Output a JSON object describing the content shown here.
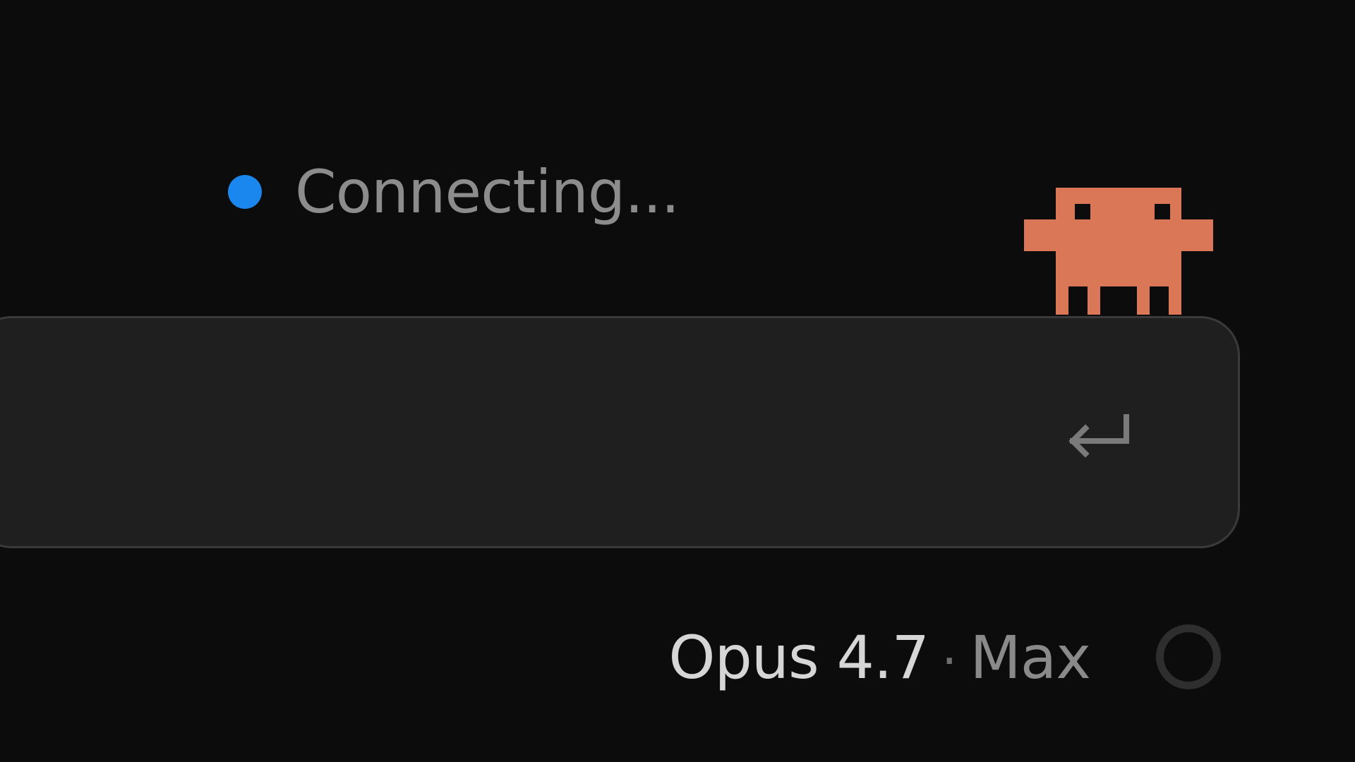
{
  "status": {
    "text": "Connecting...",
    "dot_color": "#1a87ee"
  },
  "mascot": {
    "icon": "pixel-creature-icon",
    "color": "#d97757"
  },
  "prompt": {
    "value": "",
    "placeholder": "",
    "submit_icon": "enter-return-icon"
  },
  "model": {
    "name": "Opus 4.7",
    "separator": "·",
    "tier": "Max"
  },
  "context_ring": {
    "icon": "context-usage-ring-icon"
  },
  "colors": {
    "background": "#0c0c0c",
    "input_background": "#1f1f1f",
    "input_border": "#3a3a3a",
    "muted_text": "#8c8c8c",
    "primary_text": "#d6d6d6"
  }
}
